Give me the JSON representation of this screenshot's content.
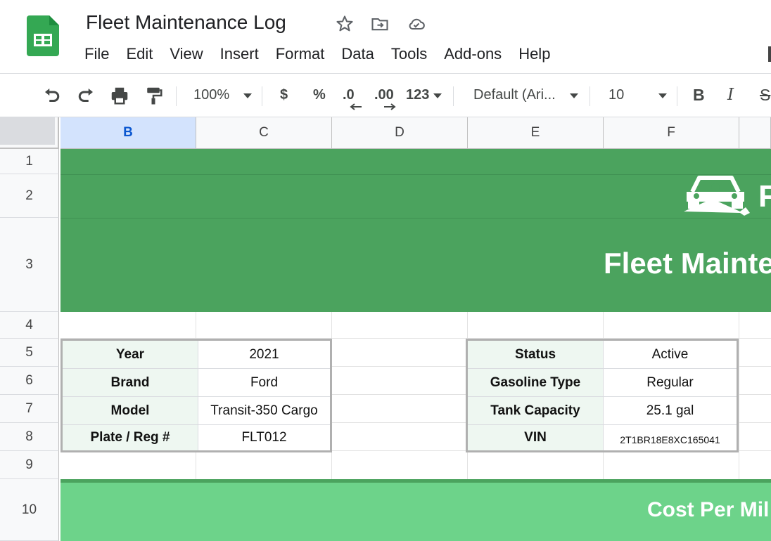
{
  "app": {
    "title": "Fleet Maintenance Log",
    "title_icons": [
      "star-icon",
      "move-to-folder-icon",
      "cloud-saved-icon"
    ],
    "menu": [
      "File",
      "Edit",
      "View",
      "Insert",
      "Format",
      "Data",
      "Tools",
      "Add-ons",
      "Help"
    ]
  },
  "toolbar": {
    "zoom": "100%",
    "currency": "$",
    "percent": "%",
    "decrease_decimal": ".0",
    "increase_decimal": ".00",
    "more_formats": "123",
    "font": "Default (Ari...",
    "font_size": "10",
    "bold": "B",
    "italic": "I",
    "strike": "S"
  },
  "grid": {
    "columns": [
      "B",
      "C",
      "D",
      "E",
      "F"
    ],
    "selected_column": "B",
    "rows": [
      "1",
      "2",
      "3",
      "4",
      "5",
      "6",
      "7",
      "8",
      "9",
      "10"
    ]
  },
  "banner": {
    "title": "Fleet Mainte",
    "logo_letter": "F",
    "color": "#4ba35e"
  },
  "vehicle_info": [
    {
      "label": "Year",
      "value": "2021"
    },
    {
      "label": "Brand",
      "value": "Ford"
    },
    {
      "label": "Model",
      "value": "Transit-350 Cargo"
    },
    {
      "label": "Plate / Reg #",
      "value": "FLT012"
    }
  ],
  "status_info": [
    {
      "label": "Status",
      "value": "Active"
    },
    {
      "label": "Gasoline Type",
      "value": "Regular"
    },
    {
      "label": "Tank Capacity",
      "value": "25.1 gal"
    },
    {
      "label": "VIN",
      "value": "2T1BR18E8XC165041"
    }
  ],
  "section": {
    "title": "Cost Per Mil",
    "color": "#6dd38a"
  }
}
